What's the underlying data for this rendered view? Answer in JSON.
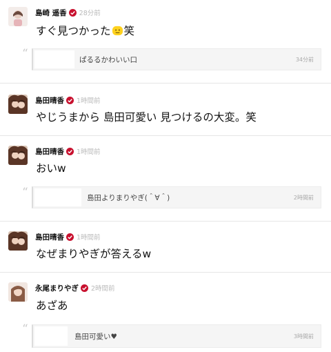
{
  "posts": [
    {
      "name": "島崎 遥香",
      "time": "28分前",
      "text": "すぐ見つかった",
      "text_suffix": "笑",
      "emoji": "smiling-face-emoji",
      "avatar": "avatar-shimazaki",
      "reply": {
        "text": "ぱるるかわいい口",
        "time": "34分前"
      }
    },
    {
      "name": "島田晴香",
      "time": "1時間前",
      "text": "やじうまから 島田可愛い 見つけるの大変。笑",
      "avatar": "avatar-shimada"
    },
    {
      "name": "島田晴香",
      "time": "1時間前",
      "text": "おいw",
      "avatar": "avatar-shimada",
      "reply": {
        "text": "島田よりまりやぎ(＾∀＾)",
        "time": "2時間前"
      }
    },
    {
      "name": "島田晴香",
      "time": "1時間前",
      "text": "なぜまりやぎが答えるw",
      "avatar": "avatar-shimada"
    },
    {
      "name": "永尾まりやぎ",
      "time": "2時間前",
      "text": "あざあ",
      "avatar": "avatar-nagao",
      "reply": {
        "text": "島田可愛い♥",
        "time": "3時間前"
      }
    }
  ],
  "quote_mark": "“",
  "colors": {
    "verified": "#c8102e",
    "meta": "#b9b9b9",
    "divider": "#e6e6e6",
    "reply_bg": "#f5f5f5"
  }
}
